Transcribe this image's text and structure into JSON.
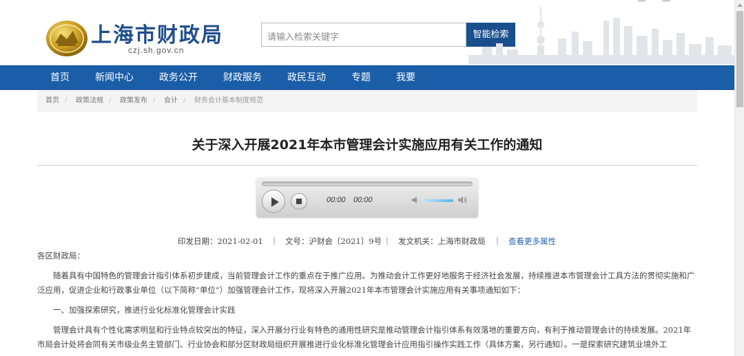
{
  "header": {
    "site_title": "上海市财政局",
    "domain": "czj.sh.gov.cn",
    "search_placeholder": "请输入检索关键字",
    "search_button": "智能检索"
  },
  "nav": {
    "items": [
      "首页",
      "新闻中心",
      "政务公开",
      "财政服务",
      "政民互动",
      "专题",
      "我要"
    ]
  },
  "breadcrumb": [
    "首页",
    "政策法规",
    "政策发布",
    "会计",
    "财务会计基本制度规范"
  ],
  "article": {
    "title": "关于深入开展2021年本市管理会计实施应用有关工作的通知",
    "player": {
      "current_time": "00:00",
      "duration": "00:00",
      "volume_level": 0.75
    },
    "meta": {
      "date": "印发日期：2021-02-01",
      "doc_no": "文号：沪财会〔2021〕9号",
      "issuer": "发文机关：上海市财政局",
      "more_link": "查看更多属性"
    },
    "paragraphs": [
      "各区财政局：",
      "随着具有中国特色的管理会计指引体系初步建成，当前管理会计工作的重点在于推广应用。为推动会计工作更好地服务于经济社会发展，持续推进本市管理会计工具方法的贯彻实施和广泛应用，促进企业和行政事业单位（以下简称“单位”）加强管理会计工作，现将深入开展2021年本市管理会计实施应用有关事项通知如下：",
      "一、加强探索研究，推进行业化标准化管理会计实践",
      "管理会计具有个性化需求明显和行业特点较突出的特征，深入开展分行业有特色的通用性研究是推动管理会计指引体系有效落地的重要方向，有利于推动管理会计的持续发展。2021年市局会计处将会同有关市级业务主管部门、行业协会和部分区财政局组织开展推进行业化标准化管理会计应用指引操作实践工作（具体方案，另行通知）。一是探索研究建筑业境外工"
    ]
  },
  "colors": {
    "brand_blue": "#1a5ea8",
    "search_button": "#1a4f8e",
    "link": "#2a65ad"
  }
}
